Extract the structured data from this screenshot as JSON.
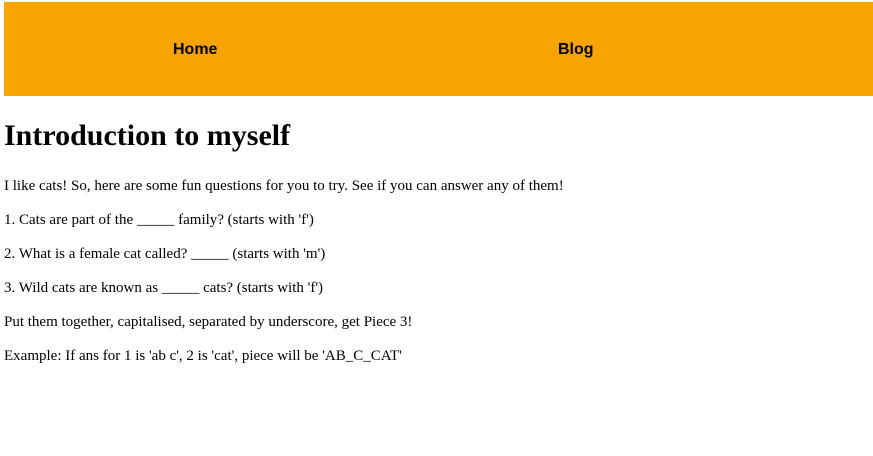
{
  "nav": {
    "background": "#f7a300",
    "items": [
      {
        "label": "Home"
      },
      {
        "label": "Blog"
      }
    ]
  },
  "main": {
    "title": "Introduction to myself",
    "intro": "I like cats! So, here are some fun questions for you to try. See if you can answer any of them!",
    "questions": [
      "1. Cats are part of the _____ family? (starts with 'f')",
      "2. What is a female cat called? _____ (starts with 'm')",
      "3. Wild cats are known as _____ cats? (starts with 'f')"
    ],
    "instruction": "Put them together, capitalised, separated by underscore, get Piece 3!",
    "example": "Example: If ans for 1 is 'ab c', 2 is 'cat', piece will be 'AB_C_CAT'"
  }
}
